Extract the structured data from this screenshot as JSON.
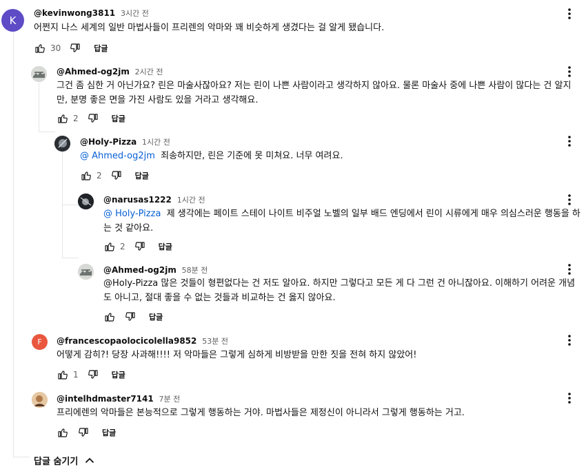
{
  "comments": {
    "c1": {
      "author": "@kevinwong3811",
      "time": "3시간 전",
      "text": "어쩐지 나스 세계의 일반 마법사들이 프리렌의 악마와 꽤 비슷하게 생겼다는 걸 알게 됐습니다.",
      "likes": "30",
      "reply": "답글",
      "avatar_letter": "K",
      "avatar_color": "#5e4bc6"
    },
    "c2": {
      "author": "@Ahmed-og2jm",
      "time": "2시간 전",
      "text": "그건 좀 심한 거 아닌가요? 린은 마술사잖아요? 저는 린이 나쁜 사람이라고 생각하지 않아요. 물론 마술사 중에 나쁜 사람이 많다는 건 알지만, 분명 좋은 면을 가진 사람도 있을 거라고 생각해요.",
      "likes": "2",
      "reply": "답글"
    },
    "c3": {
      "author": "@Holy-Pizza",
      "time": "1시간 전",
      "mention": "@ Ahmed-og2jm",
      "text": "죄송하지만, 린은 기준에 못 미쳐요. 너무 여려요.",
      "likes": "2",
      "reply": "답글"
    },
    "c4": {
      "author": "@narusas1222",
      "time": "1시간 전",
      "mention": "@ Holy-Pizza",
      "text": "제 생각에는 페이트 스테이 나이트 비주얼 노벨의 일부 배드 엔딩에서 린이 시류에게 매우 의심스러운 행동을 하는 것 같아요.",
      "likes": "2",
      "reply": "답글"
    },
    "c5": {
      "author": "@Ahmed-og2jm",
      "time": "58분 전",
      "text": "@Holy-Pizza 많은 것들이 형편없다는 건 저도 알아요. 하지만 그렇다고 모든 게 다 그런 건 아니잖아요. 이해하기 어려운 개념도 아니고, 절대 좋을 수 없는 것들과 비교하는 건 옳지 않아요.",
      "likes": "",
      "reply": "답글"
    },
    "c6": {
      "author": "@francescopaolocicolella9852",
      "time": "53분 전",
      "text": "어떻게 감히?! 당장 사과해!!!! 저 악마들은 그렇게 심하게 비방받을 만한 짓을 전혀 하지 않았어!",
      "likes": "1",
      "reply": "답글",
      "avatar_letter": "F",
      "avatar_color": "#e9573f"
    },
    "c7": {
      "author": "@intelhdmaster7141",
      "time": "7분 전",
      "text": "프리에렌의 악마들은 본능적으로 그렇게 행동하는 거야. 마법사들은 제정신이 아니라서 그렇게 행동하는 거고.",
      "likes": "",
      "reply": "답글"
    }
  },
  "hide_replies_label": "답글 숨기기",
  "colors": {
    "mention": "#065fd4",
    "thread_line": "#e5e5e5",
    "secondary_text": "#606060"
  },
  "icons": [
    "thumb-up-icon",
    "thumb-down-icon",
    "more-vert-icon",
    "chevron-up-icon"
  ]
}
